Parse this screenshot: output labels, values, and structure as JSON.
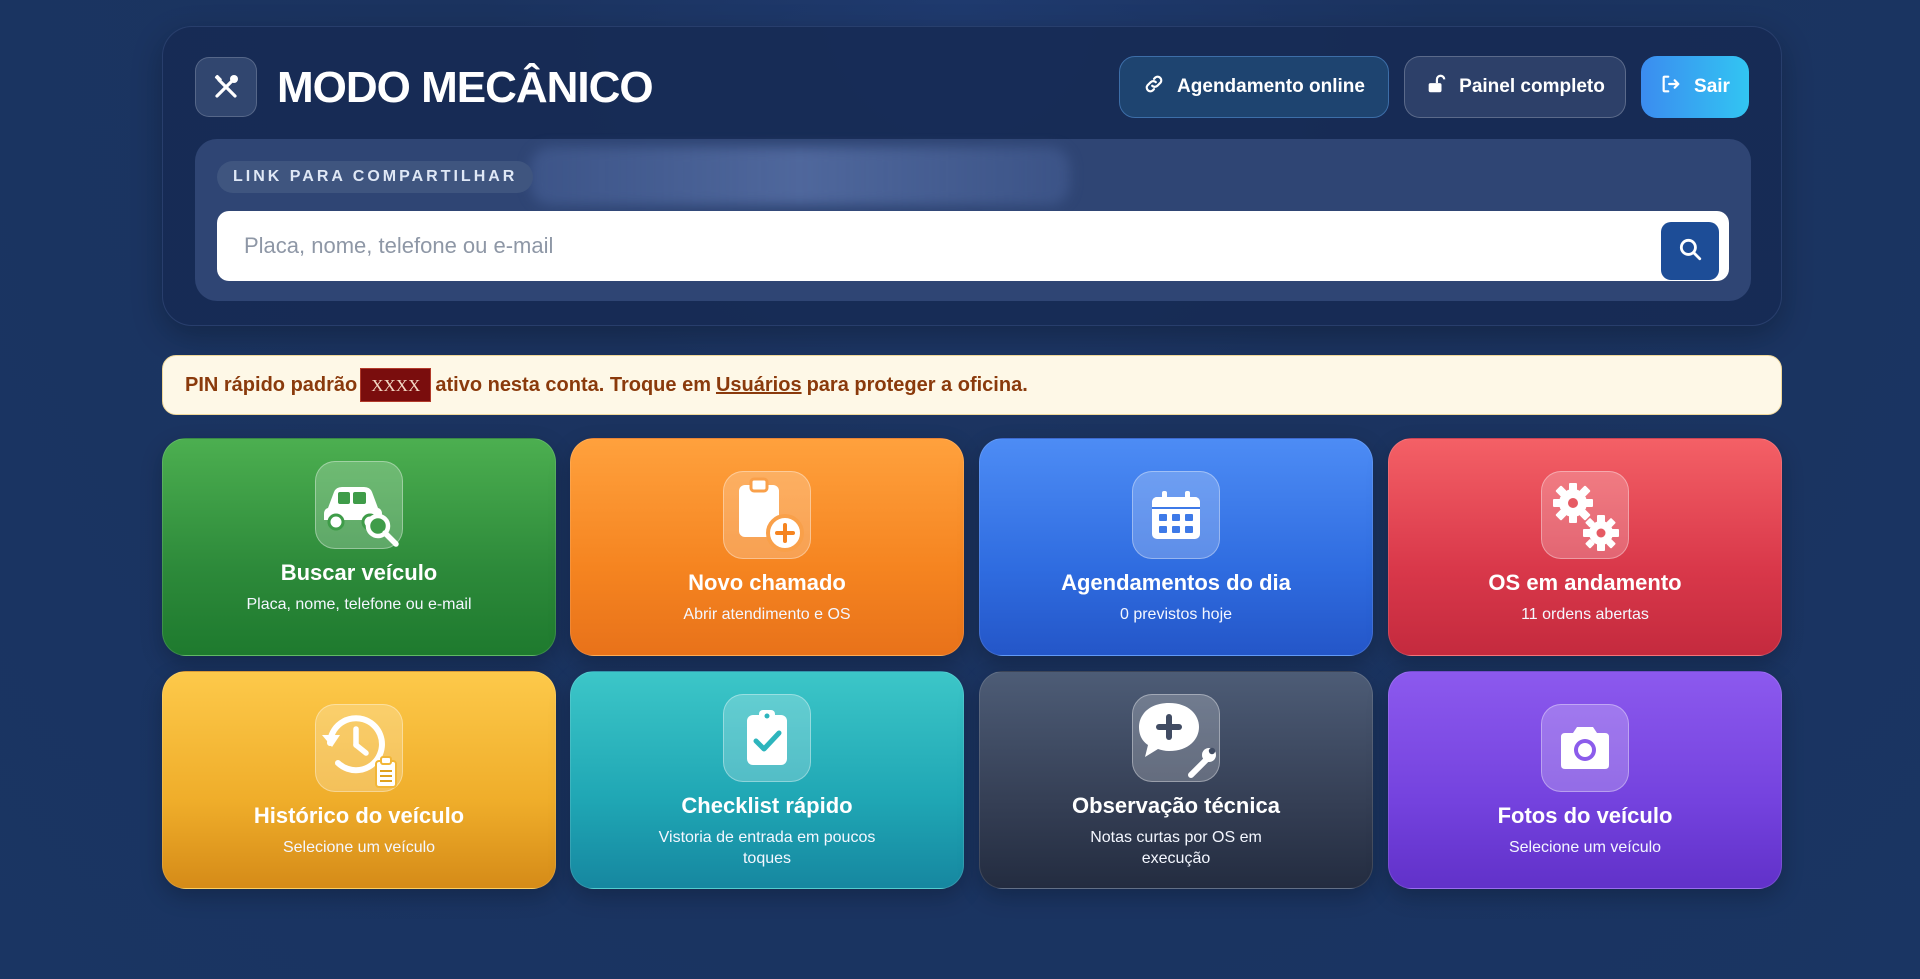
{
  "header": {
    "title": "MODO MECÂNICO",
    "buttons": {
      "online": "Agendamento online",
      "painel": "Painel completo",
      "sair": "Sair"
    }
  },
  "share": {
    "label": "LINK PARA COMPARTILHAR",
    "search_placeholder": "Placa, nome, telefone ou e-mail"
  },
  "pin_banner": {
    "prefix": "PIN rápido padrão",
    "code": "XXXX",
    "middle": "ativo nesta conta. Troque em",
    "link": "Usuários",
    "suffix": "para proteger a oficina."
  },
  "tiles": [
    {
      "title": "Buscar veículo",
      "subtitle": "Placa, nome, telefone ou e-mail",
      "color": "#2d8a3a",
      "icon": "car-search-icon"
    },
    {
      "title": "Novo chamado",
      "subtitle": "Abrir atendimento e OS",
      "color": "#f58420",
      "icon": "clipboard-plus-icon"
    },
    {
      "title": "Agendamentos do dia",
      "subtitle": "0 previstos hoje",
      "color": "#2f6ce0",
      "icon": "calendar-icon"
    },
    {
      "title": "OS em andamento",
      "subtitle": "11 ordens abertas",
      "color": "#d9384a",
      "icon": "gears-icon"
    },
    {
      "title": "Histórico do veículo",
      "subtitle": "Selecione um veículo",
      "color": "#efad2a",
      "icon": "history-icon"
    },
    {
      "title": "Checklist rápido",
      "subtitle": "Vistoria de entrada em poucos toques",
      "color": "#1fa6b4",
      "icon": "clipboard-check-icon"
    },
    {
      "title": "Observação técnica",
      "subtitle": "Notas curtas por OS em execução",
      "color": "#353f55",
      "icon": "comment-wrench-icon"
    },
    {
      "title": "Fotos do veículo",
      "subtitle": "Selecione um veículo",
      "color": "#7442de",
      "icon": "camera-icon"
    }
  ]
}
